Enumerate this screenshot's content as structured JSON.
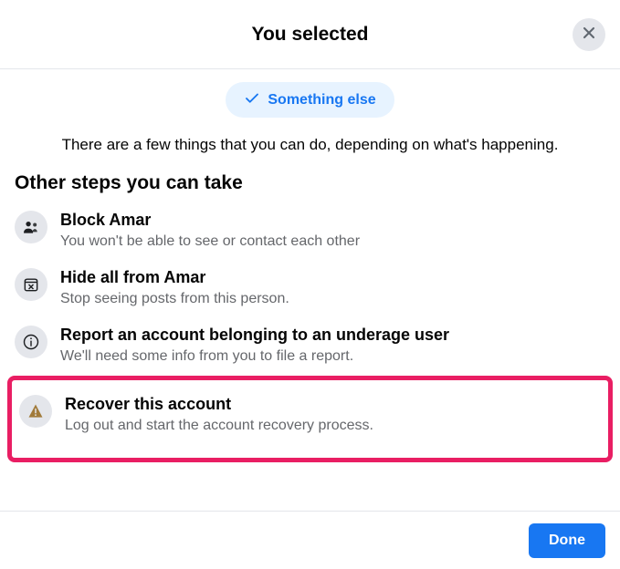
{
  "header": {
    "title": "You selected"
  },
  "chip": {
    "label": "Something else"
  },
  "description": "There are a few things that you can do, depending on what's happening.",
  "section_title": "Other steps you can take",
  "steps": [
    {
      "title": "Block Amar",
      "subtitle": "You won't be able to see or contact each other"
    },
    {
      "title": "Hide all from Amar",
      "subtitle": "Stop seeing posts from this person."
    },
    {
      "title": "Report an account belonging to an underage user",
      "subtitle": "We'll need some info from you to file a report."
    },
    {
      "title": "Recover this account",
      "subtitle": "Log out and start the account recovery process."
    }
  ],
  "footer": {
    "done_label": "Done"
  }
}
